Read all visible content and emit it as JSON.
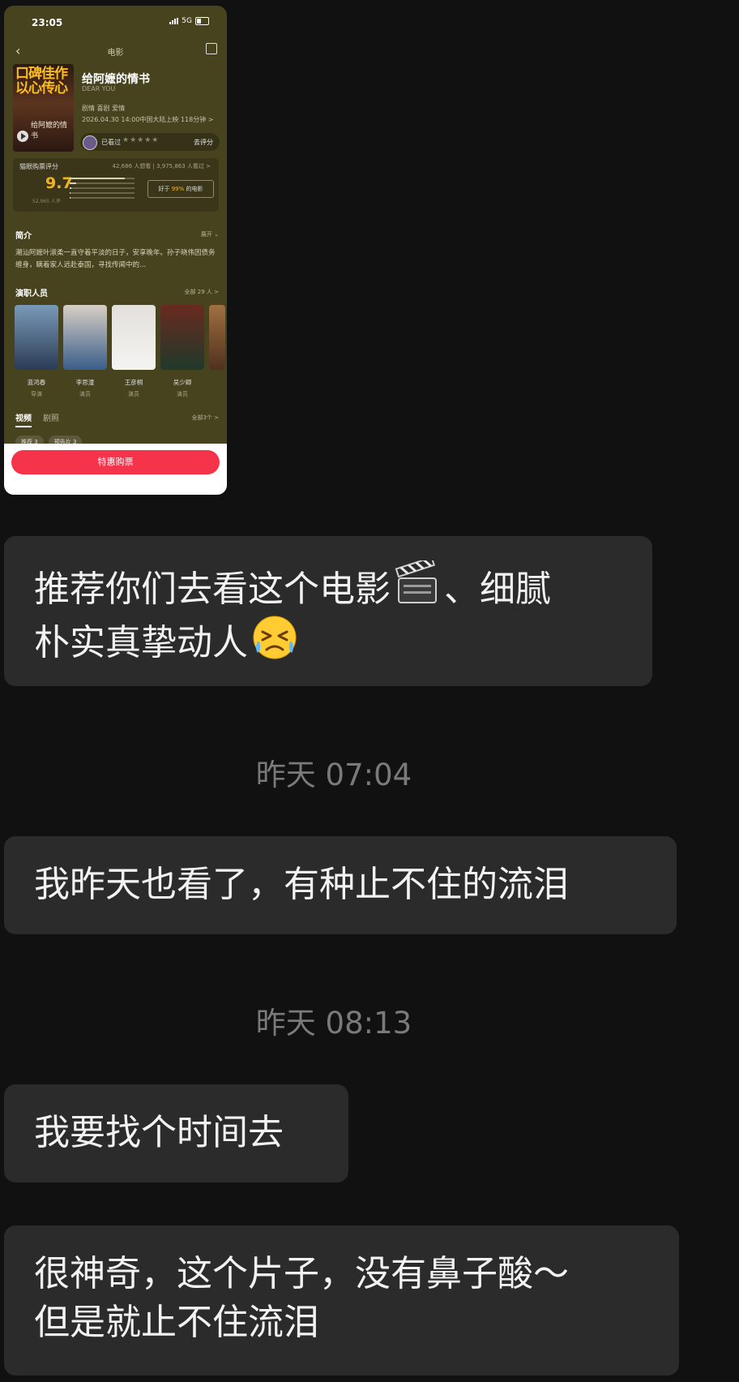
{
  "shared_card": {
    "status": {
      "time": "23:05",
      "network": "5G"
    },
    "nav_title": "电影",
    "poster": {
      "slogan": "口碑佳作 以心传心",
      "cal": "给阿嬷的情书"
    },
    "movie": {
      "title": "给阿嬷的情书",
      "english_title": "DEAR YOU",
      "genre": "剧情 喜剧 爱情",
      "release": "2026.04.30 14:00中国大陆上映 118分钟 >"
    },
    "rating_bar": {
      "seen_label": "已看过",
      "stars": "★★★★★",
      "rate_label": "去评分"
    },
    "score": {
      "label": "猫眼购票评分",
      "stats": "42,686 人想看 | 3,975,863 人看过 >",
      "value": "9.7",
      "count": "52,965 人评",
      "quote": "好于 99% 的电影",
      "quote_pre": "好于 ",
      "quote_pct": "99%",
      "quote_post": " 的电影",
      "bars": [
        0.85,
        0.1,
        0.03,
        0.01,
        0.01
      ]
    },
    "intro": {
      "heading": "简介",
      "expand": "展开 ⌄",
      "text": "潮汕阿嬷叶淑柔一直守着平淡的日子，安享晚年。孙子晓伟因债务缠身，瞒着家人远赴泰国，寻找传闻中的..."
    },
    "cast": {
      "heading": "演职人员",
      "more": "全部 29 人 >",
      "people": [
        {
          "name": "蓝鸿春",
          "role": "导演"
        },
        {
          "name": "李思潼",
          "role": "演员"
        },
        {
          "name": "王彦桐",
          "role": "演员"
        },
        {
          "name": "吴少卿",
          "role": "演员"
        }
      ]
    },
    "media": {
      "tabs": [
        "视频",
        "剧照"
      ],
      "more": "全部3个 >",
      "chips": [
        "推荐 3",
        "预告片 3"
      ]
    },
    "buy_button": "特惠购票"
  },
  "messages": [
    {
      "kind": "bubble",
      "lines": [
        "推荐你们去看这个电影",
        "、细腻",
        "朴实真挚动人"
      ],
      "emojis": [
        "clapper-board-icon",
        "crying-face-icon"
      ]
    },
    {
      "kind": "time",
      "text": "昨天 07:04"
    },
    {
      "kind": "bubble",
      "text": "我昨天也看了，有种止不住的流泪"
    },
    {
      "kind": "time",
      "text": "昨天 08:13"
    },
    {
      "kind": "bubble",
      "text": "我要找个时间去"
    },
    {
      "kind": "bubble",
      "lines": [
        "很神奇，这个片子，没有鼻子酸～",
        "但是就止不住流泪"
      ]
    }
  ],
  "colors": {
    "background": "#111111",
    "bubble": "#2b2b2b",
    "timestamp": "#7a7a7a",
    "buy_button": "#f5334a",
    "score": "#f3b51f"
  }
}
